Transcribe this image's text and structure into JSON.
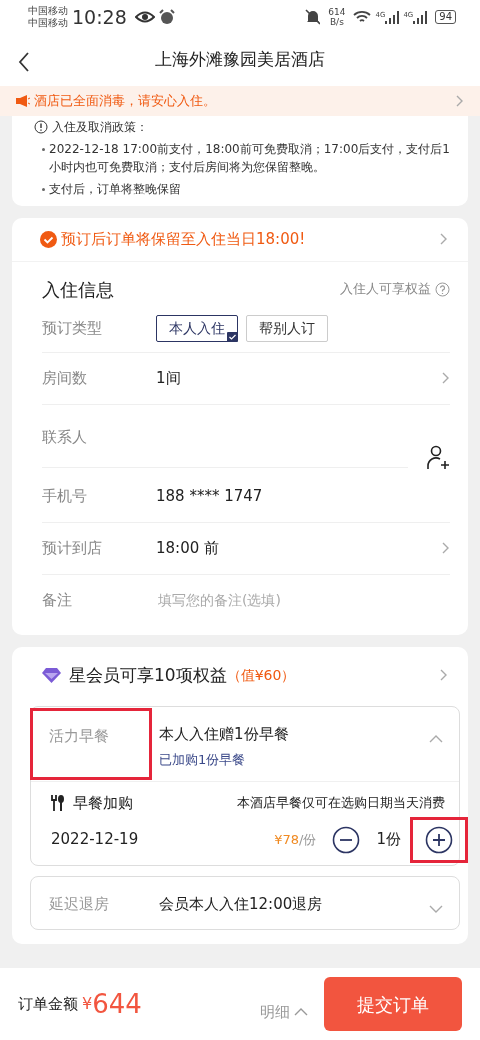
{
  "status_bar": {
    "carriers": [
      "中国移动",
      "中国移动"
    ],
    "time": "10:28",
    "net_speed": [
      "614",
      "B/s"
    ],
    "signal_labels": [
      "4G",
      "4G"
    ],
    "battery": "94"
  },
  "header": {
    "title": "上海外滩豫园美居酒店"
  },
  "notice": {
    "text": "酒店已全面消毒，请安心入住。"
  },
  "policy": {
    "title": "入住及取消政策：",
    "items": [
      "2022-12-18 17:00前支付，18:00前可免费取消；17:00后支付，支付后1小时内也可免费取消；支付后房间将为您保留整晚。",
      "支付后，订单将整晚保留"
    ]
  },
  "guarantee": {
    "text": "预订后订单将保留至入住当日18:00!"
  },
  "checkin": {
    "title": "入住信息",
    "benefit_link": "入住人可享权益",
    "rows": [
      {
        "kind": "options",
        "label": "预订类型",
        "options": [
          {
            "label": "本人入住",
            "selected": true
          },
          {
            "label": "帮别人订",
            "selected": false
          }
        ]
      },
      {
        "kind": "select",
        "label": "房间数",
        "value": "1间"
      },
      {
        "kind": "contact",
        "label": "联系人"
      },
      {
        "kind": "text",
        "label": "手机号",
        "value": "188 **** 1747"
      },
      {
        "kind": "select",
        "label": "预计到店",
        "value": "18:00 前"
      },
      {
        "kind": "input",
        "label": "备注",
        "placeholder": "填写您的备注(选填)"
      }
    ]
  },
  "member": {
    "title": "星会员可享10项权益",
    "value": "（值¥60）"
  },
  "benefits": [
    {
      "label": "活力早餐",
      "title": "本人入住赠1份早餐",
      "sub": "已加购1份早餐",
      "expanded": true,
      "highlighted": true,
      "addon": {
        "title": "早餐加购",
        "note": "本酒店早餐仅可在选购日期当天消费",
        "items": [
          {
            "date": "2022-12-19",
            "price": "¥78",
            "unit": "/份",
            "qty": "1份",
            "plus_highlighted": true
          }
        ]
      }
    },
    {
      "label": "延迟退房",
      "title": "会员本人入住12:00退房",
      "expanded": false,
      "highlighted": false
    }
  ],
  "footer": {
    "label": "订单金额",
    "currency": "¥",
    "amount": "644",
    "detail": "明细",
    "submit": "提交订单"
  }
}
